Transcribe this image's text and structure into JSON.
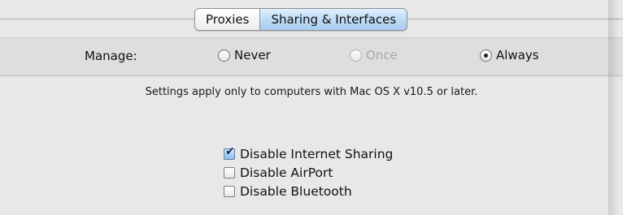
{
  "tabs": [
    {
      "label": "Proxies",
      "active": false
    },
    {
      "label": "Sharing & Interfaces",
      "active": true
    }
  ],
  "manage": {
    "label": "Manage:",
    "options": [
      {
        "label": "Never",
        "selected": false,
        "disabled": false
      },
      {
        "label": "Once",
        "selected": false,
        "disabled": true
      },
      {
        "label": "Always",
        "selected": true,
        "disabled": false
      }
    ]
  },
  "note": "Settings apply only to computers with Mac OS X v10.5 or later.",
  "checkboxes": [
    {
      "label": "Disable Internet Sharing",
      "checked": true
    },
    {
      "label": "Disable AirPort",
      "checked": false
    },
    {
      "label": "Disable Bluetooth",
      "checked": false
    }
  ]
}
